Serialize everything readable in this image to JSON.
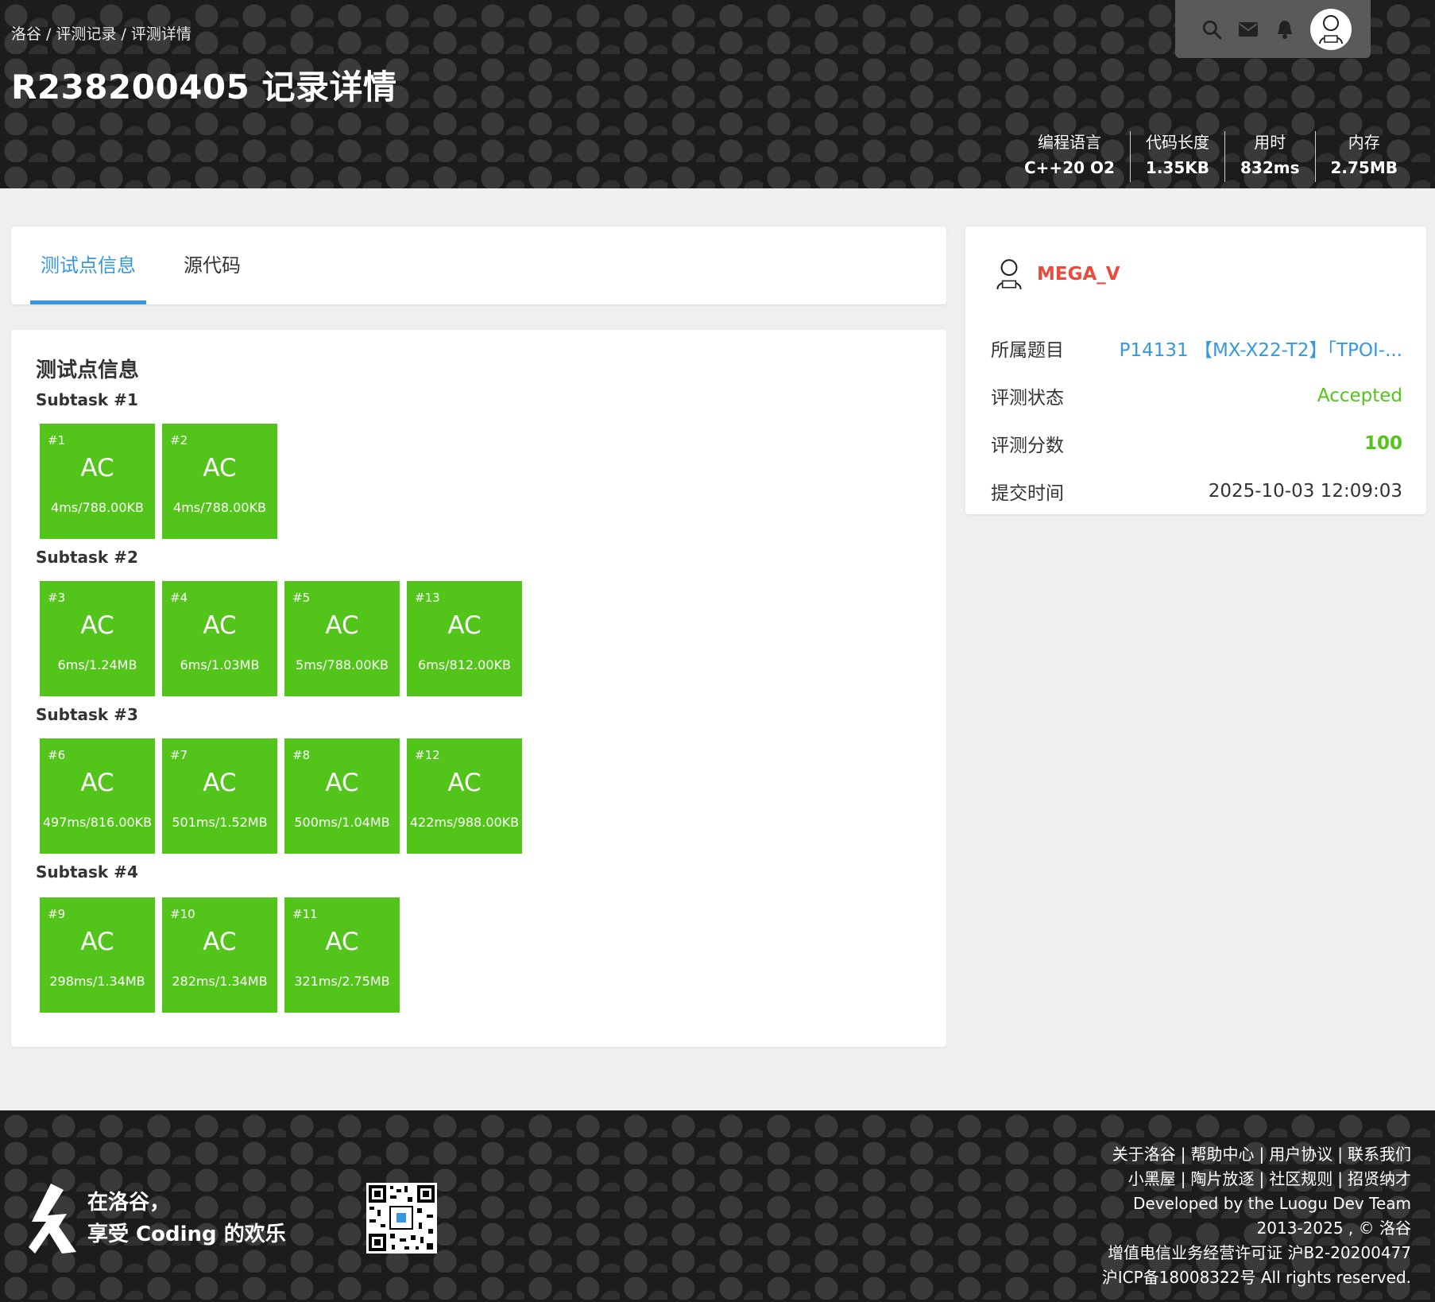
{
  "breadcrumb": [
    "洛谷",
    "/",
    "评测记录",
    "/",
    "评测详情"
  ],
  "title": "R238200405 记录详情",
  "stats": [
    {
      "label": "编程语言",
      "value": "C++20 O2"
    },
    {
      "label": "代码长度",
      "value": "1.35KB"
    },
    {
      "label": "用时",
      "value": "832ms"
    },
    {
      "label": "内存",
      "value": "2.75MB"
    }
  ],
  "tabs": [
    "测试点信息",
    "源代码"
  ],
  "testcases": {
    "title": "测试点信息",
    "subtasks": [
      {
        "name": "Subtask #1",
        "cases": [
          {
            "id": "#1",
            "status": "AC",
            "info": "4ms/788.00KB"
          },
          {
            "id": "#2",
            "status": "AC",
            "info": "4ms/788.00KB"
          }
        ]
      },
      {
        "name": "Subtask #2",
        "cases": [
          {
            "id": "#3",
            "status": "AC",
            "info": "6ms/1.24MB"
          },
          {
            "id": "#4",
            "status": "AC",
            "info": "6ms/1.03MB"
          },
          {
            "id": "#5",
            "status": "AC",
            "info": "5ms/788.00KB"
          },
          {
            "id": "#13",
            "status": "AC",
            "info": "6ms/812.00KB"
          }
        ]
      },
      {
        "name": "Subtask #3",
        "cases": [
          {
            "id": "#6",
            "status": "AC",
            "info": "497ms/816.00KB"
          },
          {
            "id": "#7",
            "status": "AC",
            "info": "501ms/1.52MB"
          },
          {
            "id": "#8",
            "status": "AC",
            "info": "500ms/1.04MB"
          },
          {
            "id": "#12",
            "status": "AC",
            "info": "422ms/988.00KB"
          }
        ]
      },
      {
        "name": "Subtask #4",
        "cases": [
          {
            "id": "#9",
            "status": "AC",
            "info": "298ms/1.34MB"
          },
          {
            "id": "#10",
            "status": "AC",
            "info": "282ms/1.34MB"
          },
          {
            "id": "#11",
            "status": "AC",
            "info": "321ms/2.75MB"
          }
        ]
      }
    ]
  },
  "info": {
    "username": "MEGA_V",
    "problem_label": "所属题目",
    "problem_value": "P14131 【MX-X22-T2】「TPOI-...",
    "status_label": "评测状态",
    "status_value": "Accepted",
    "score_label": "评测分数",
    "score_value": "100",
    "time_label": "提交时间",
    "time_value": "2025-10-03 12:09:03"
  },
  "footer": {
    "slogan_line1": "在洛谷，",
    "slogan_line2": "享受 Coding 的欢乐",
    "links_row1": [
      "关于洛谷",
      "帮助中心",
      "用户协议",
      "联系我们"
    ],
    "links_row2": [
      "小黑屋",
      "陶片放逐",
      "社区规则",
      "招贤纳才"
    ],
    "dev_prefix": "Developed by the ",
    "dev_team": "Luogu Dev Team",
    "copyright": "2013-2025 , © 洛谷",
    "license": "增值电信业务经营许可证 沪B2-20200477",
    "icp": "沪ICP备18008322号",
    "rights": " All rights reserved."
  },
  "colors": {
    "accent": "#3498db",
    "ac_green": "#52c41a",
    "username_red": "#e74c3c"
  },
  "icons": [
    "search-icon",
    "mail-icon",
    "bell-icon",
    "avatar"
  ]
}
